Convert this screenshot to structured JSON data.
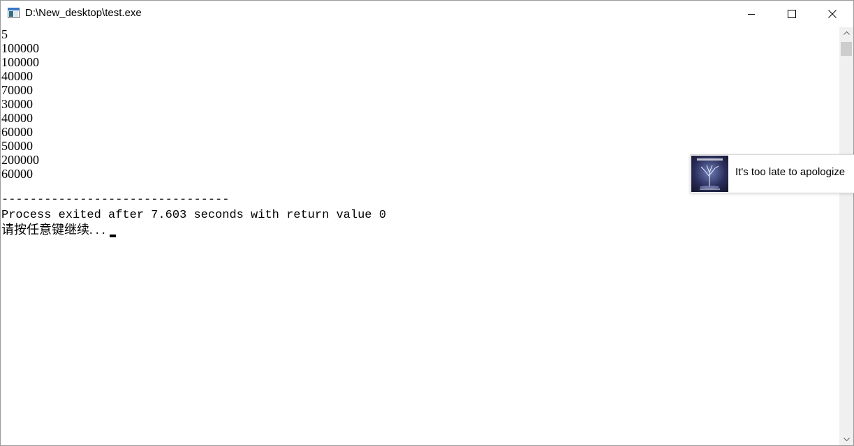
{
  "window": {
    "title": "D:\\New_desktop\\test.exe"
  },
  "console": {
    "output_lines": [
      "5",
      "100000",
      "100000",
      "40000",
      "70000",
      "30000",
      "40000",
      "60000",
      "50000",
      "200000",
      "60000"
    ],
    "separator": "--------------------------------",
    "exit_message": "Process exited after 7.603 seconds with return value 0",
    "prompt": "请按任意键继续. . . "
  },
  "notification": {
    "text": "It's too late to apologize"
  },
  "colors": {
    "background": "#ffffff",
    "text": "#000000",
    "scrollbar_track": "#f0f0f0",
    "scrollbar_thumb": "#cdcdcd"
  }
}
